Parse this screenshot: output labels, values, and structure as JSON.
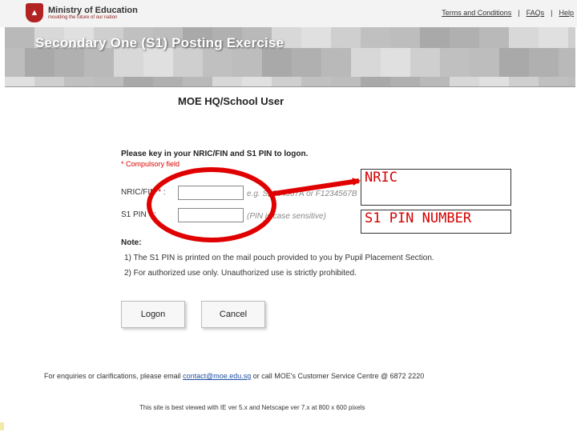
{
  "header": {
    "org_name": "Ministry of Education",
    "org_tagline": "moulding the future of our nation",
    "links": [
      "Terms and Conditions",
      "FAQs",
      "Help"
    ]
  },
  "banner": {
    "title": "Secondary One (S1) Posting Exercise"
  },
  "login": {
    "heading": "MOE HQ/School User",
    "instruction": "Please key in your NRIC/FIN and S1 PIN to logon.",
    "compulsory_note": "* Compulsory field",
    "nric_label": "NRIC/FIN",
    "nric_hint": "e.g. S1234567A or F1234567B",
    "pin_label": "S1 PIN",
    "pin_hint": "(PIN is case sensitive)",
    "nric_value": "",
    "pin_value": ""
  },
  "notes": {
    "title": "Note:",
    "items": [
      "1)  The S1 PIN is printed on the mail pouch provided to you by Pupil Placement Section.",
      "2)  For authorized use only. Unauthorized use is strictly prohibited."
    ]
  },
  "buttons": {
    "logon": "Logon",
    "cancel": "Cancel"
  },
  "footer": {
    "enquiry_prefix": "For enquiries or clarifications, please email ",
    "email": "contact@moe.edu.sg",
    "enquiry_suffix": " or call MOE's Customer Service Centre @  6872 2220",
    "best_viewed": "This site is best viewed with IE ver 5.x and Netscape ver 7.x at 800 x 600 pixels"
  },
  "annotation": {
    "label_nric": "NRIC",
    "label_pin": "S1 PIN NUMBER",
    "color": "#e00000"
  }
}
